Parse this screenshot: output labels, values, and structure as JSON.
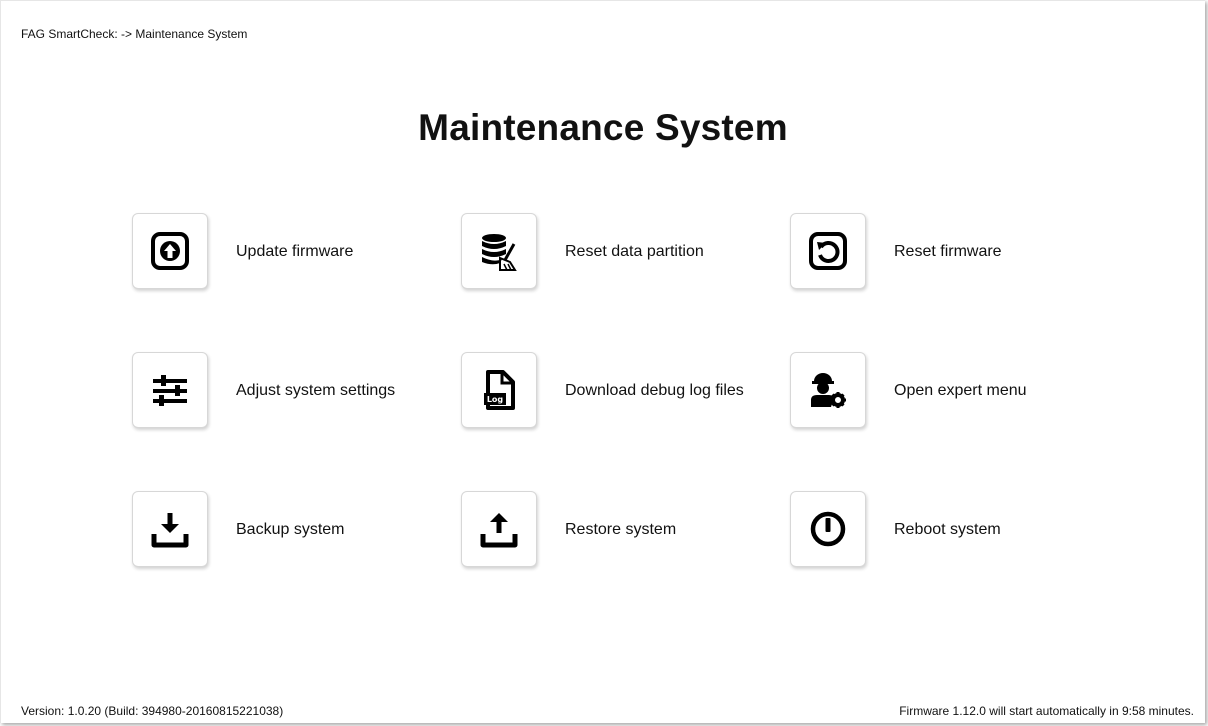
{
  "breadcrumb": "FAG SmartCheck: -> Maintenance System",
  "title": "Maintenance System",
  "actions": [
    {
      "label": "Update firmware",
      "icon": "upload-circle-icon"
    },
    {
      "label": "Reset data partition",
      "icon": "database-broom-icon"
    },
    {
      "label": "Reset firmware",
      "icon": "reset-arrow-icon"
    },
    {
      "label": "Adjust system settings",
      "icon": "sliders-icon"
    },
    {
      "label": "Download debug log files",
      "icon": "log-file-icon"
    },
    {
      "label": "Open expert menu",
      "icon": "expert-user-gear-icon"
    },
    {
      "label": "Backup system",
      "icon": "download-tray-icon"
    },
    {
      "label": "Restore system",
      "icon": "upload-tray-icon"
    },
    {
      "label": "Reboot system",
      "icon": "power-icon"
    }
  ],
  "footer": {
    "version": "Version: 1.0.20 (Build: 394980-20160815221038)",
    "firmware_notice": "Firmware 1.12.0 will start automatically in 9:58 minutes."
  }
}
